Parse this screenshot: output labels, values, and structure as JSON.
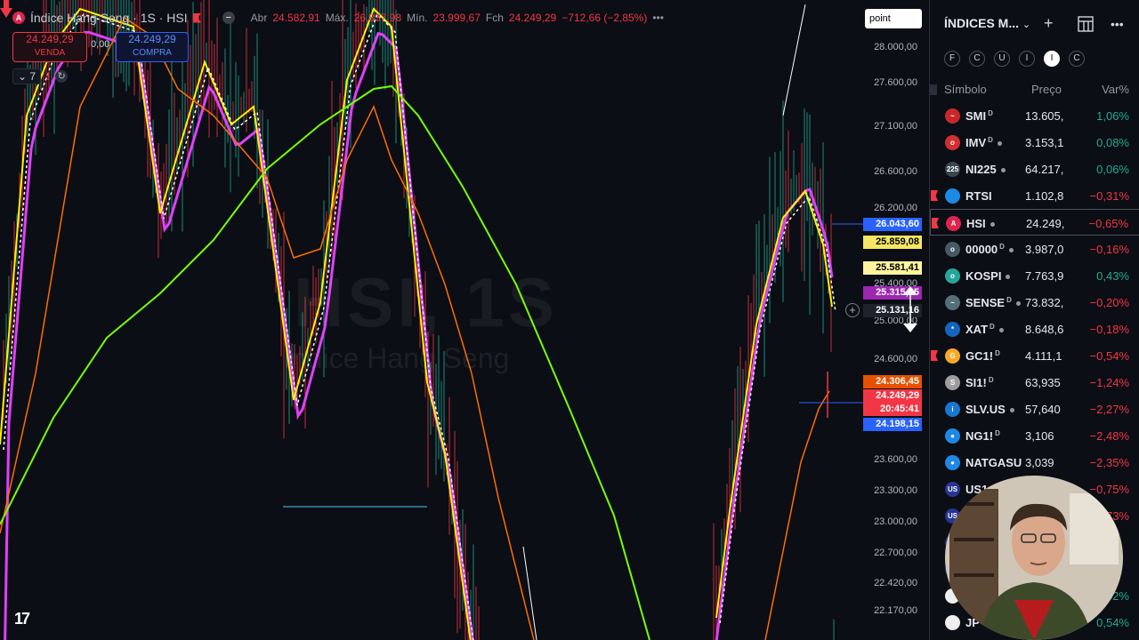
{
  "chart": {
    "symbol_title": "Índice Hang Seng · 1S · HSI",
    "open_label": "Abr",
    "open_value": "24.582,91",
    "high_label": "Máx.",
    "high_value": "26.837,98",
    "low_label": "Mín.",
    "low_value": "23.999,67",
    "close_label": "Fch",
    "close_value": "24.249,29",
    "change": "−712,66 (−2,85%)",
    "sell_price": "24.249,29",
    "sell_label": "VENDA",
    "spread": "0,00",
    "buy_price": "24.249,29",
    "buy_label": "COMPRA",
    "indicator_count": "7",
    "watermark_symbol": "HSI, 1S",
    "watermark_name": "Índice Hang Seng",
    "scale_mode_button": "point",
    "y_axis_labels": [
      "28.000,00",
      "27.600,00",
      "27.100,00",
      "26.600,00",
      "26.200,00",
      "25.400,00",
      "25.000,00",
      "24.600,00",
      "23.600,00",
      "23.300,00",
      "23.000,00",
      "22.700,00",
      "22.420,00",
      "22.170,00"
    ],
    "price_tags": [
      {
        "value": "26.043,60",
        "bg": "#2962ff",
        "fg": "#ffffff"
      },
      {
        "value": "25.859,08",
        "bg": "#f5e663",
        "fg": "#000000"
      },
      {
        "value": "25.581,41",
        "bg": "#fff59d",
        "fg": "#000000"
      },
      {
        "value": "25.315,45",
        "bg": "#9c27b0",
        "fg": "#ffffff"
      },
      {
        "value": "25.131,16",
        "bg": "#1e222d",
        "fg": "#ffffff"
      },
      {
        "value": "24.306,45",
        "bg": "#e65100",
        "fg": "#ffffff"
      },
      {
        "value": "24.249,29",
        "bg": "#f23645",
        "fg": "#ffffff"
      },
      {
        "value": "20:45:41",
        "bg": "#f23645",
        "fg": "#ffffff"
      },
      {
        "value": "24.198,15",
        "bg": "#2962ff",
        "fg": "#ffffff"
      }
    ],
    "colors": {
      "up": "#22ab94",
      "down": "#f23645",
      "ema_fast": "#fff200",
      "ema_mid": "#e040fb",
      "ema_slow": "#ff6d00",
      "ema_long": "#76ff03"
    }
  },
  "watchlist": {
    "title": "ÍNDICES M...",
    "filters": [
      "F",
      "C",
      "U",
      "I",
      "I",
      "C"
    ],
    "active_filter": 4,
    "columns": {
      "symbol": "Símbolo",
      "price": "Preço",
      "change": "Var%"
    },
    "rows": [
      {
        "symbol": "SMI",
        "sup": "D",
        "dot": false,
        "price": "13.605,",
        "change": "1,06%",
        "dir": "pos",
        "flag": false,
        "icon_bg": "#c62828",
        "icon_text": "~"
      },
      {
        "symbol": "IMV",
        "sup": "D",
        "dot": true,
        "price": "3.153,1",
        "change": "0,08%",
        "dir": "pos",
        "flag": false,
        "icon_bg": "#d32f2f",
        "icon_text": "o"
      },
      {
        "symbol": "NI225",
        "sup": "",
        "dot": true,
        "price": "64.217,",
        "change": "0,06%",
        "dir": "pos",
        "flag": false,
        "icon_bg": "#37474f",
        "icon_text": "225"
      },
      {
        "symbol": "RTSI",
        "sup": "",
        "dot": false,
        "price": "1.102,8",
        "change": "−0,31%",
        "dir": "neg",
        "flag": true,
        "icon_bg": "#1e88e5",
        "icon_text": ""
      },
      {
        "symbol": "HSI",
        "sup": "",
        "dot": true,
        "price": "24.249,",
        "change": "−0,65%",
        "dir": "neg",
        "flag": true,
        "icon_bg": "#e0244d",
        "icon_text": "A",
        "selected": true
      },
      {
        "symbol": "00000",
        "sup": "D",
        "dot": true,
        "price": "3.987,0",
        "change": "−0,16%",
        "dir": "neg",
        "flag": false,
        "icon_bg": "#455a64",
        "icon_text": "o"
      },
      {
        "symbol": "KOSPI",
        "sup": "",
        "dot": true,
        "price": "7.763,9",
        "change": "0,43%",
        "dir": "pos",
        "flag": false,
        "icon_bg": "#26a69a",
        "icon_text": "o"
      },
      {
        "symbol": "SENSE",
        "sup": "D",
        "dot": true,
        "price": "73.832,",
        "change": "−0,20%",
        "dir": "neg",
        "flag": false,
        "icon_bg": "#546e7a",
        "icon_text": "~"
      },
      {
        "symbol": "XAT",
        "sup": "D",
        "dot": true,
        "price": "8.648,6",
        "change": "−0,18%",
        "dir": "neg",
        "flag": false,
        "icon_bg": "#1565c0",
        "icon_text": "*"
      },
      {
        "symbol": "GC1!",
        "sup": "D",
        "dot": false,
        "price": "4.111,1",
        "change": "−0,54%",
        "dir": "neg",
        "flag": true,
        "icon_bg": "#f9a825",
        "icon_text": "G"
      },
      {
        "symbol": "SI1!",
        "sup": "D",
        "dot": false,
        "price": "63,935",
        "change": "−1,24%",
        "dir": "neg",
        "flag": false,
        "icon_bg": "#9e9e9e",
        "icon_text": "S"
      },
      {
        "symbol": "SLV.US",
        "sup": "",
        "dot": true,
        "price": "57,640",
        "change": "−2,27%",
        "dir": "neg",
        "flag": false,
        "icon_bg": "#1976d2",
        "icon_text": "i"
      },
      {
        "symbol": "NG1!",
        "sup": "D",
        "dot": false,
        "price": "3,106",
        "change": "−2,48%",
        "dir": "neg",
        "flag": false,
        "icon_bg": "#1e88e5",
        "icon_text": "●"
      },
      {
        "symbol": "NATGASU",
        "sup": "",
        "dot": false,
        "price": "3,039",
        "change": "−2,35%",
        "dir": "neg",
        "flag": false,
        "icon_bg": "#1e88e5",
        "icon_text": "●"
      },
      {
        "symbol": "US1",
        "sup": "",
        "dot": false,
        "price": "",
        "change": "−0,75%",
        "dir": "neg",
        "flag": false,
        "icon_bg": "#283593",
        "icon_text": "US"
      },
      {
        "symbol": "",
        "sup": "",
        "dot": false,
        "price": "",
        "change": "73%",
        "dir": "neg",
        "flag": false,
        "icon_bg": "#283593",
        "icon_text": "US"
      },
      {
        "symbol": "",
        "sup": "",
        "dot": false,
        "price": "",
        "change": "",
        "dir": "neg",
        "flag": false,
        "icon_bg": "#283593",
        "icon_text": ""
      },
      {
        "symbol": "",
        "sup": "",
        "dot": false,
        "price": "",
        "change": "",
        "dir": "neg",
        "flag": false,
        "icon_bg": "#283593",
        "icon_text": ""
      },
      {
        "symbol": "",
        "sup": "",
        "dot": false,
        "price": "",
        "change": "52%",
        "dir": "pos",
        "flag": false,
        "icon_bg": "#eeeeee",
        "icon_text": ""
      },
      {
        "symbol": "JP",
        "sup": "",
        "dot": false,
        "price": "",
        "change": "0,54%",
        "dir": "pos",
        "flag": false,
        "icon_bg": "#eeeeee",
        "icon_text": ""
      }
    ]
  }
}
